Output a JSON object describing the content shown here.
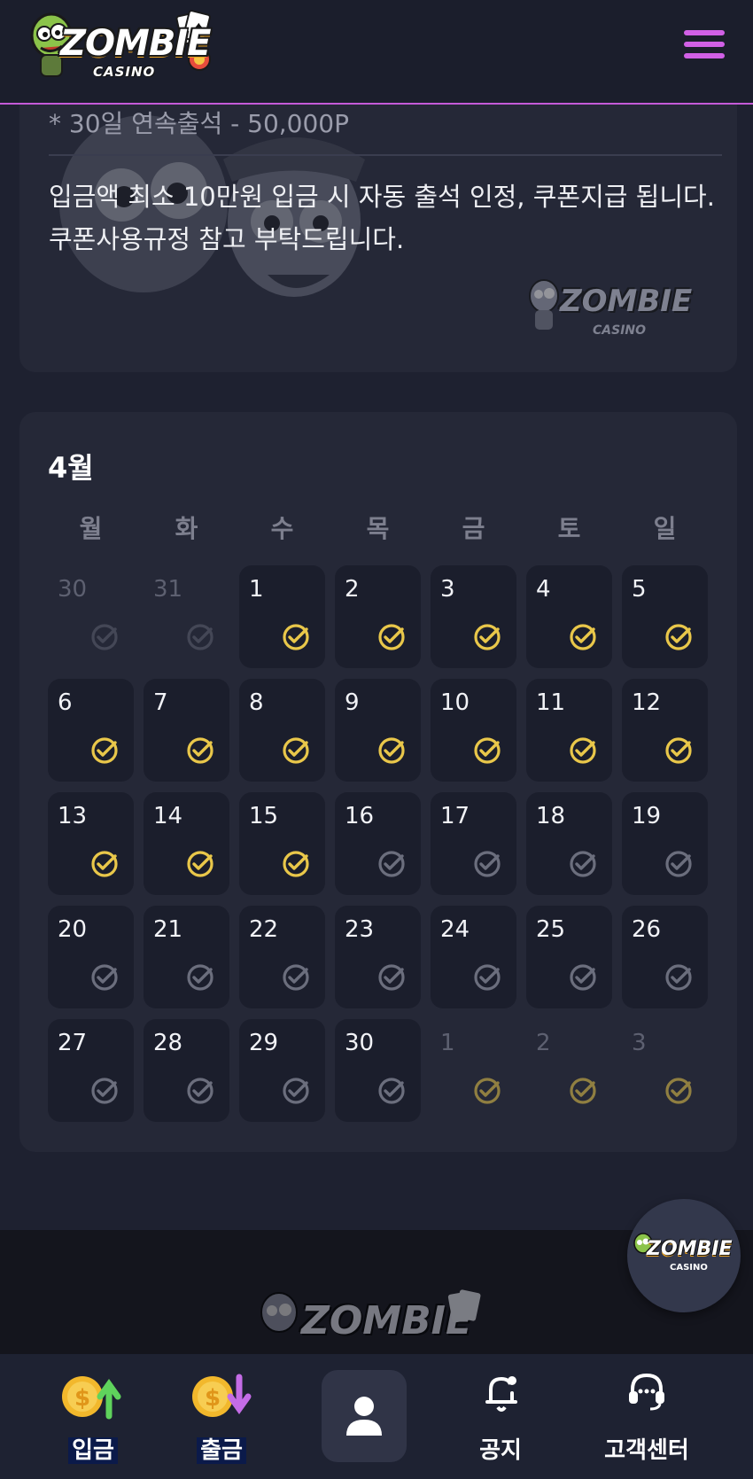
{
  "header": {
    "logo_text": "ZOMBIE",
    "logo_sub": "CASINO"
  },
  "info": {
    "line1": "* 30일 연속출석 - 50,000P",
    "paragraph1": "입금액 최소 10만원 입금 시 자동 출석 인정, 쿠폰지급 됩니다.",
    "paragraph2": "쿠폰사용규정 참고 부탁드립니다.",
    "watermark_text": "ZOMBIE",
    "watermark_sub": "CASINO"
  },
  "calendar": {
    "month": "4월",
    "weekdays": [
      "월",
      "화",
      "수",
      "목",
      "금",
      "토",
      "일"
    ],
    "days": [
      {
        "n": "30",
        "other": true,
        "checked": false
      },
      {
        "n": "31",
        "other": true,
        "checked": false
      },
      {
        "n": "1",
        "other": false,
        "checked": true
      },
      {
        "n": "2",
        "other": false,
        "checked": true
      },
      {
        "n": "3",
        "other": false,
        "checked": true
      },
      {
        "n": "4",
        "other": false,
        "checked": true
      },
      {
        "n": "5",
        "other": false,
        "checked": true
      },
      {
        "n": "6",
        "other": false,
        "checked": true
      },
      {
        "n": "7",
        "other": false,
        "checked": true
      },
      {
        "n": "8",
        "other": false,
        "checked": true
      },
      {
        "n": "9",
        "other": false,
        "checked": true
      },
      {
        "n": "10",
        "other": false,
        "checked": true
      },
      {
        "n": "11",
        "other": false,
        "checked": true
      },
      {
        "n": "12",
        "other": false,
        "checked": true
      },
      {
        "n": "13",
        "other": false,
        "checked": true
      },
      {
        "n": "14",
        "other": false,
        "checked": true
      },
      {
        "n": "15",
        "other": false,
        "checked": true
      },
      {
        "n": "16",
        "other": false,
        "checked": false
      },
      {
        "n": "17",
        "other": false,
        "checked": false
      },
      {
        "n": "18",
        "other": false,
        "checked": false
      },
      {
        "n": "19",
        "other": false,
        "checked": false
      },
      {
        "n": "20",
        "other": false,
        "checked": false
      },
      {
        "n": "21",
        "other": false,
        "checked": false
      },
      {
        "n": "22",
        "other": false,
        "checked": false
      },
      {
        "n": "23",
        "other": false,
        "checked": false
      },
      {
        "n": "24",
        "other": false,
        "checked": false
      },
      {
        "n": "25",
        "other": false,
        "checked": false
      },
      {
        "n": "26",
        "other": false,
        "checked": false
      },
      {
        "n": "27",
        "other": false,
        "checked": false
      },
      {
        "n": "28",
        "other": false,
        "checked": false
      },
      {
        "n": "29",
        "other": false,
        "checked": false
      },
      {
        "n": "30",
        "other": false,
        "checked": false
      },
      {
        "n": "1",
        "other": true,
        "checked": true
      },
      {
        "n": "2",
        "other": true,
        "checked": true
      },
      {
        "n": "3",
        "other": true,
        "checked": true
      }
    ]
  },
  "footer": {
    "logo_text": "ZOMBIE"
  },
  "float_button": {
    "logo_text": "ZOMBIE",
    "logo_sub": "CASINO"
  },
  "nav": {
    "deposit": "입금",
    "withdraw": "출금",
    "notice": "공지",
    "support": "고객센터"
  },
  "colors": {
    "accent": "#d160e6",
    "check_active": "#e9c74a",
    "check_inactive": "#6b6e7d",
    "background": "#1e2130",
    "card": "#252837"
  },
  "icons": {
    "menu": "hamburger-icon",
    "check": "check-circle-icon",
    "deposit": "coin-up-icon",
    "withdraw": "coin-down-icon",
    "profile": "user-icon",
    "notice": "bell-icon",
    "support": "headset-icon"
  }
}
